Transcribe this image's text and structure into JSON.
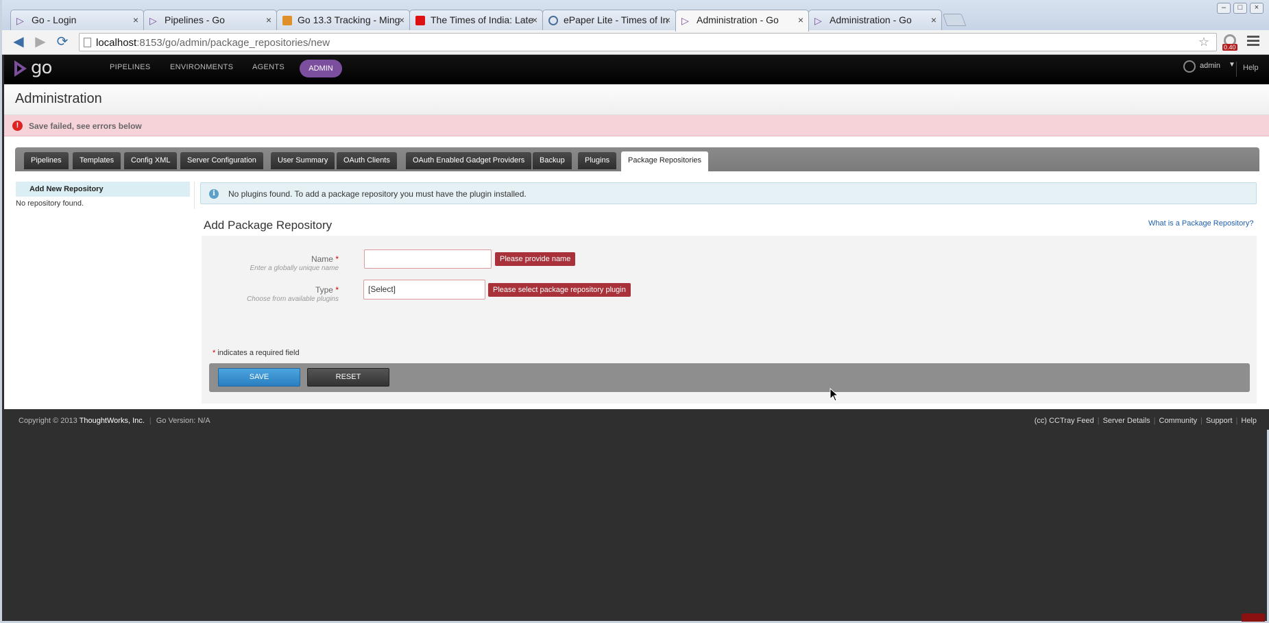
{
  "browser": {
    "tabs": [
      {
        "title": "Go - Login",
        "icon": "go-icon"
      },
      {
        "title": "Pipelines - Go",
        "icon": "go-icon"
      },
      {
        "title": "Go 13.3 Tracking - Ming",
        "icon": "tracker-icon"
      },
      {
        "title": "The Times of India: Late",
        "icon": "toi-icon"
      },
      {
        "title": "ePaper Lite - Times of In",
        "icon": "globe-icon"
      },
      {
        "title": "Administration - Go",
        "icon": "go-icon",
        "active": true
      },
      {
        "title": "Administration - Go",
        "icon": "go-icon"
      }
    ],
    "close_glyph": "×",
    "url_host": "localhost",
    "url_path": ":8153/go/admin/package_repositories/new",
    "extension_badge": "0.40",
    "window_buttons": [
      "–",
      "□",
      "×"
    ]
  },
  "header": {
    "logo_text": "go",
    "nav": [
      "PIPELINES",
      "ENVIRONMENTS",
      "AGENTS"
    ],
    "active_nav": "ADMIN",
    "user": "admin",
    "user_caret": "▼",
    "help": "Help"
  },
  "page": {
    "title": "Administration",
    "error_icon": "!",
    "error_message": "Save failed, see errors below"
  },
  "admin_tabs": [
    "Pipelines",
    "Templates",
    "Config XML",
    "Server Configuration",
    "User Summary",
    "OAuth Clients",
    "OAuth Enabled Gadget Providers",
    "Backup",
    "Plugins",
    "Package Repositories"
  ],
  "active_admin_tab": "Package Repositories",
  "sidebar": {
    "heading": "Add New Repository",
    "empty_text": "No repository found."
  },
  "info": {
    "icon": "i",
    "text": "No plugins found. To add a package repository you must have the plugin installed."
  },
  "form": {
    "title": "Add Package Repository",
    "help_link": "What is a Package Repository?",
    "required_marker": "*",
    "name_label": "Name",
    "name_hint": "Enter a globally unique name",
    "name_value": "",
    "name_error": "Please provide name",
    "type_label": "Type",
    "type_hint": "Choose from available plugins",
    "type_value": "[Select]",
    "type_error": "Please select package repository plugin",
    "required_note": "indicates a required field",
    "save_label": "SAVE",
    "reset_label": "RESET"
  },
  "footer": {
    "copyright_prefix": "Copyright © 2013",
    "company": "ThoughtWorks, Inc.",
    "version": "Go Version: N/A",
    "links": [
      "(cc) CCTray Feed",
      "Server Details",
      "Community",
      "Support",
      "Help"
    ]
  },
  "colors": {
    "brand_purple": "#7b4f9d",
    "error_bg": "#f6d2d9",
    "error_tag": "#a8313a",
    "save_blue": "#2b7fc0",
    "info_bg": "#e6f1f6"
  }
}
